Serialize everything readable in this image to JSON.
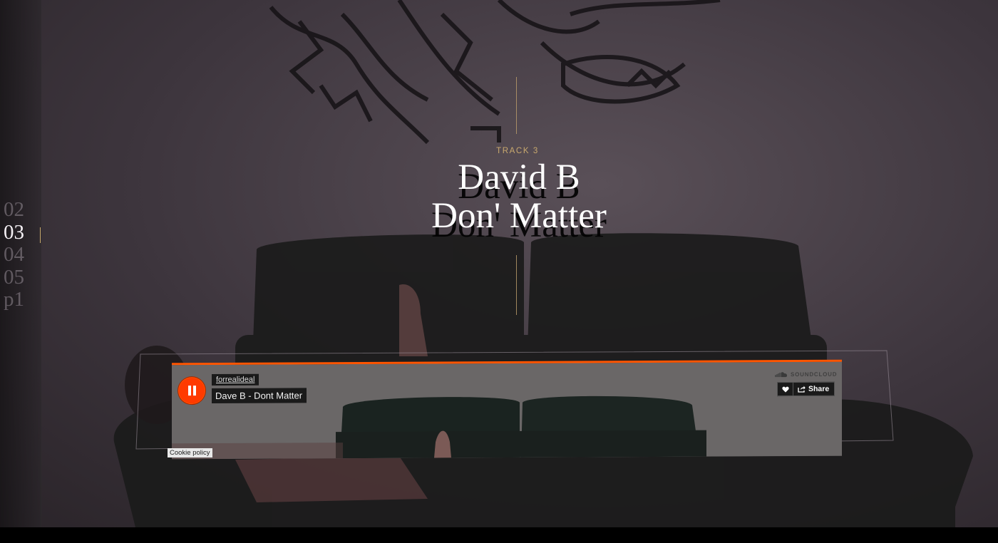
{
  "nav": {
    "items": [
      "02",
      "03",
      "04",
      "05",
      "p1"
    ],
    "active": "03"
  },
  "track": {
    "label": "TRACK 3",
    "title_line1": "David B",
    "title_line2": "Don' Matter"
  },
  "player": {
    "uploader": "forrealideal",
    "track_name": "Dave B - Dont Matter",
    "brand": "SOUNDCLOUD",
    "share_label": "Share",
    "state": "playing",
    "accent_color": "#ff5500"
  },
  "cookie_policy": "Cookie policy",
  "colors": {
    "accent_gold": "#c9a96e",
    "soundcloud_orange": "#ff5500"
  },
  "icons": [
    "pause-icon",
    "soundcloud-logo-icon",
    "heart-icon",
    "share-icon"
  ]
}
